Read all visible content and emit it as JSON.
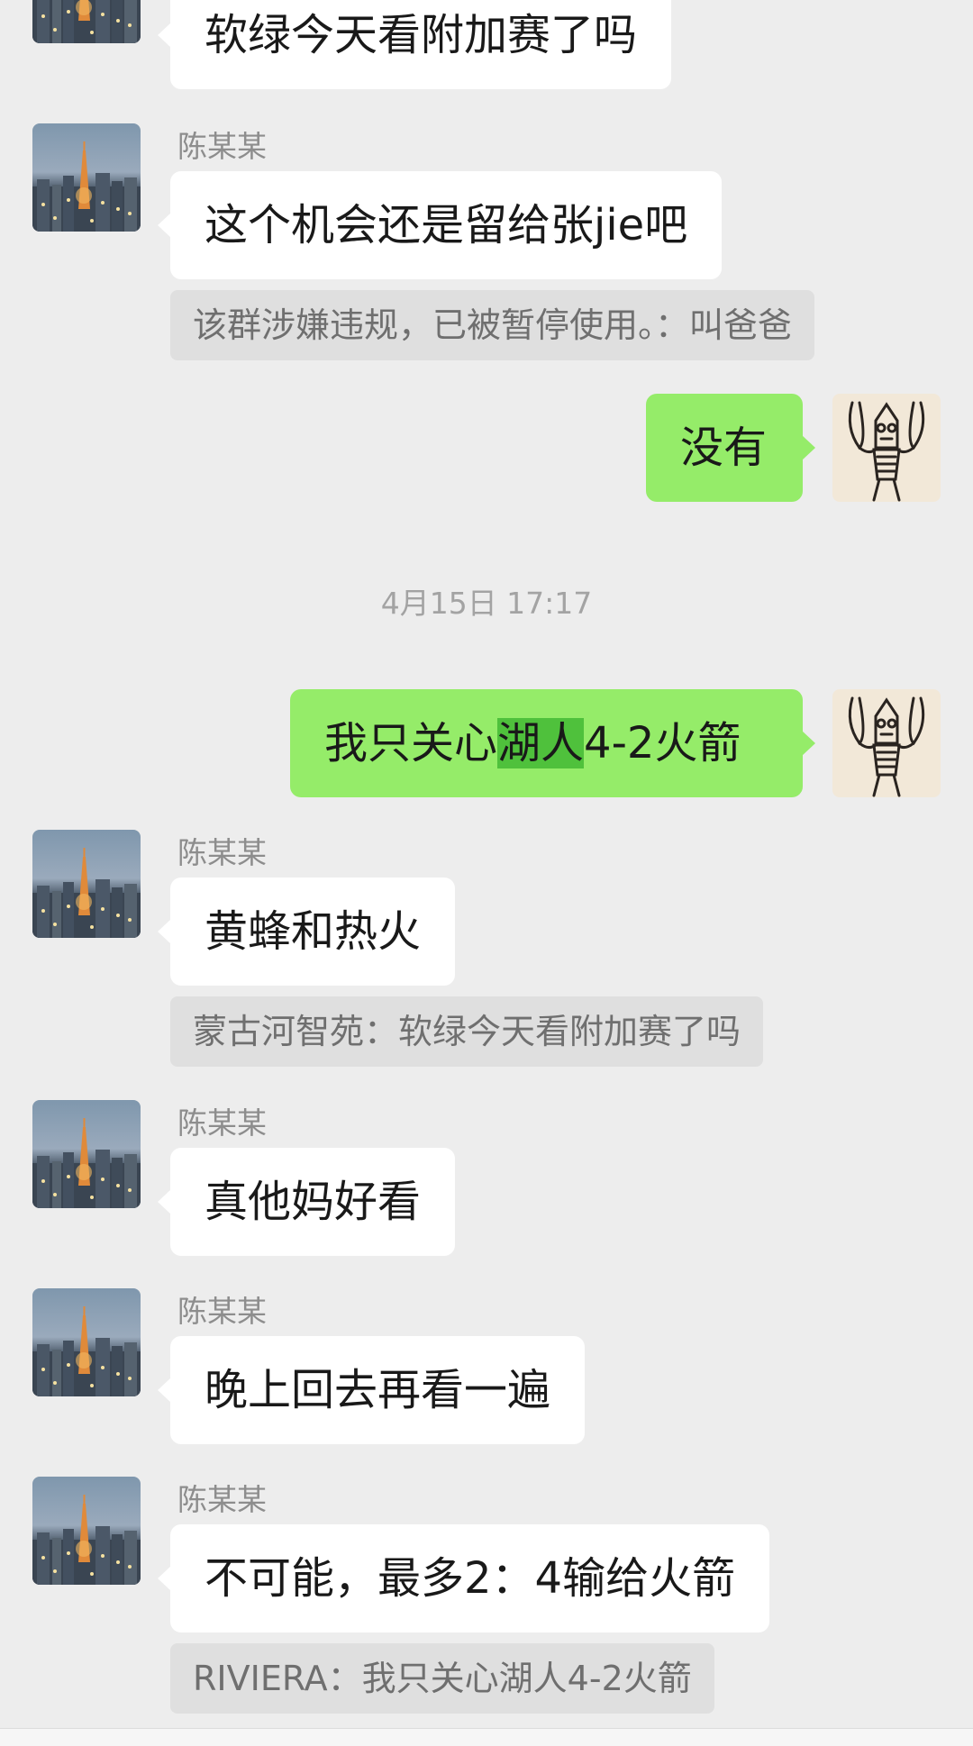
{
  "messages": [
    {
      "kind": "incoming",
      "text": "软绿今天看附加赛了吗"
    },
    {
      "kind": "incoming",
      "sender": "陈某某",
      "text": "这个机会还是留给张jie吧",
      "quote": "该群涉嫌违规，已被暂停使用。：叫爸爸"
    },
    {
      "kind": "outgoing",
      "text": "没有"
    },
    {
      "kind": "timestamp",
      "text": "4月15日 17:17"
    },
    {
      "kind": "outgoing",
      "text_before": "我只关心",
      "text_highlight": "湖人",
      "text_after": "4-2火箭"
    },
    {
      "kind": "incoming",
      "sender": "陈某某",
      "text": "黄蜂和热火",
      "quote": "蒙古河智苑：软绿今天看附加赛了吗"
    },
    {
      "kind": "incoming",
      "sender": "陈某某",
      "text": "真他妈好看"
    },
    {
      "kind": "incoming",
      "sender": "陈某某",
      "text": "晚上回去再看一遍"
    },
    {
      "kind": "incoming",
      "sender": "陈某某",
      "text": "不可能，最多2：4输给火箭",
      "quote": "RIVIERA：我只关心湖人4-2火箭"
    }
  ],
  "icons": {
    "incoming_avatar": "city-night-avatar",
    "outgoing_avatar": "monster-drawing-avatar"
  },
  "colors": {
    "background": "#ededed",
    "incoming_bubble": "#ffffff",
    "outgoing_bubble": "#95ec69",
    "highlight": "#4fc13c",
    "quote_box": "#dfdfdf"
  }
}
